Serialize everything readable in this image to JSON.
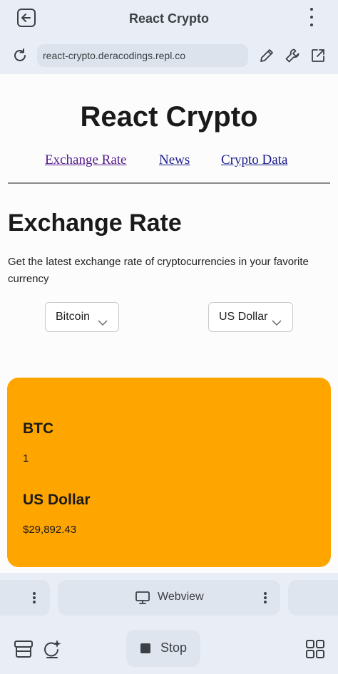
{
  "app_bar": {
    "title": "React Crypto"
  },
  "url_bar": {
    "url": "react-crypto.deracodings.repl.co"
  },
  "site": {
    "title": "React Crypto",
    "nav": [
      "Exchange Rate",
      "News",
      "Crypto Data"
    ],
    "heading": "Exchange Rate",
    "description": "Get the latest exchange rate of cryptocurrencies in your favorite currency",
    "from_select": "Bitcoin",
    "to_select": "US Dollar",
    "result": {
      "from_code": "BTC",
      "from_amount": "1",
      "to_name": "US Dollar",
      "to_amount": "$29,892.43"
    }
  },
  "panel_tabs": {
    "webview_label": "Webview"
  },
  "bottom_bar": {
    "stop_label": "Stop"
  },
  "colors": {
    "card": "#ffa500",
    "chrome": "#e9eef6",
    "link": "#1a1a8c",
    "link_visited": "#551a8b"
  },
  "icons": [
    "back-icon",
    "more-vert-icon",
    "reload-icon",
    "pencil-icon",
    "wrench-icon",
    "external-link-icon",
    "chevron-down-icon",
    "monitor-icon",
    "layers-icon",
    "assistant-icon",
    "stop-icon",
    "grid-icon"
  ]
}
